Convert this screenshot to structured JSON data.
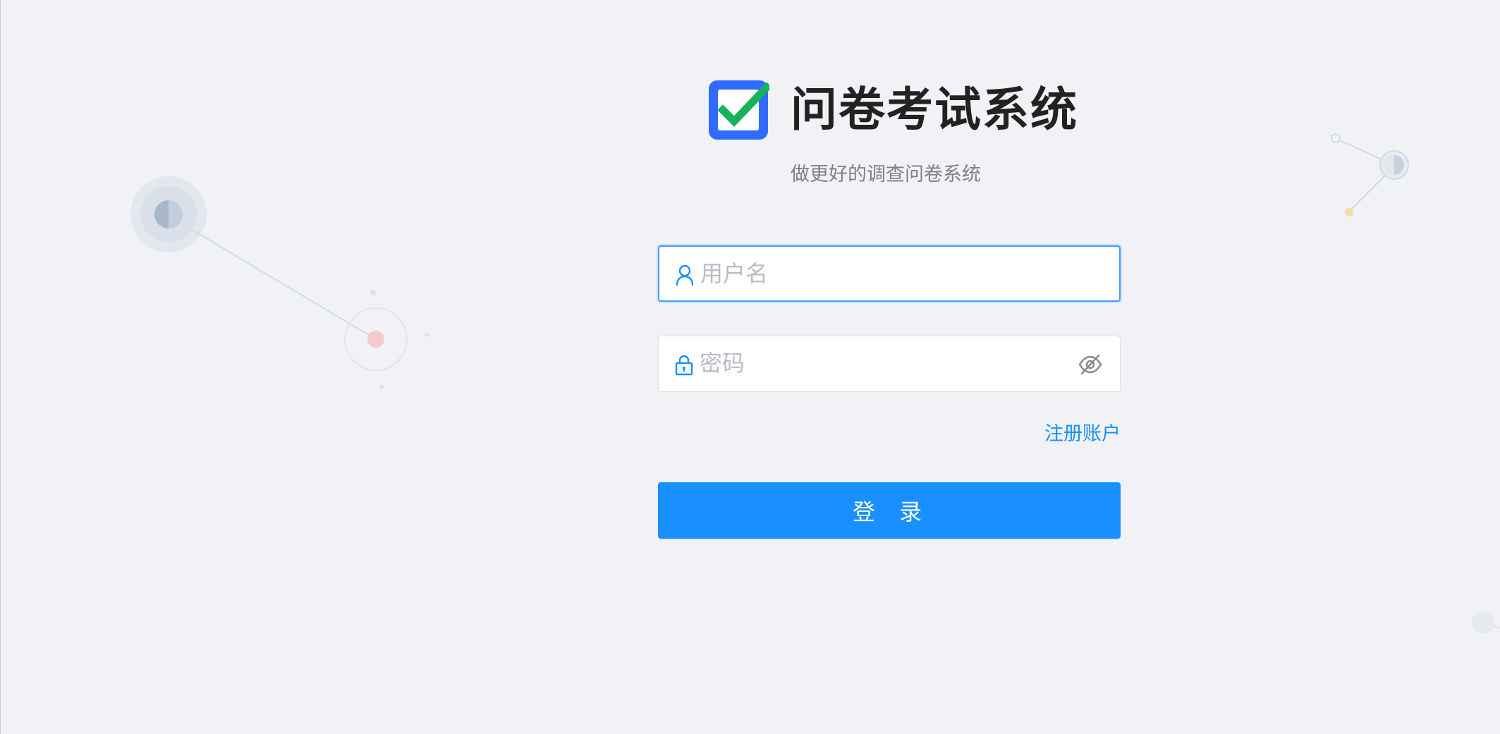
{
  "app": {
    "title": "问卷考试系统",
    "subtitle": "做更好的调查问卷系统"
  },
  "form": {
    "username": {
      "placeholder": "用户名",
      "value": "",
      "icon": "user-icon",
      "focused": true
    },
    "password": {
      "placeholder": "密码",
      "value": "",
      "icon": "lock-icon",
      "toggle_icon": "eye-hidden-icon"
    },
    "register_label": "注册账户",
    "login_label": "登 录"
  },
  "colors": {
    "background": "#f0f2f5",
    "primary": "#1890ff",
    "logo_blue": "#2f6bff",
    "logo_check": "#19b15a",
    "title": "#222222",
    "subtitle": "#808080"
  }
}
